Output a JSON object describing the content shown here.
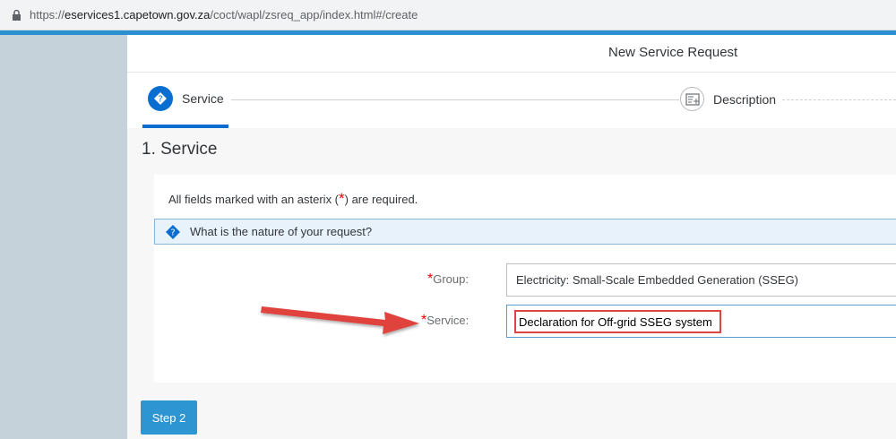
{
  "browser": {
    "url_scheme": "https://",
    "url_host": "eservices1.capetown.gov.za",
    "url_path": "/coct/wapl/zsreq_app/index.html#/create"
  },
  "header": {
    "title": "New Service Request"
  },
  "steps": [
    {
      "label": "Service"
    },
    {
      "label": "Description"
    }
  ],
  "section": {
    "title": "1. Service"
  },
  "form": {
    "required_note_before": "All fields marked with an asterix (",
    "required_note_star": "*",
    "required_note_after": ") are required.",
    "question": "What is the nature of your request?",
    "group_label": "Group:",
    "group_value": "Electricity: Small-Scale Embedded Generation (SSEG)",
    "service_label": "Service:",
    "service_value": "Declaration for Off-grid SSEG system",
    "star": "*"
  },
  "buttons": {
    "step2": "Step 2"
  },
  "colors": {
    "accent": "#0a6ed1",
    "annotation": "#e0433e",
    "button": "#2c95d2"
  }
}
